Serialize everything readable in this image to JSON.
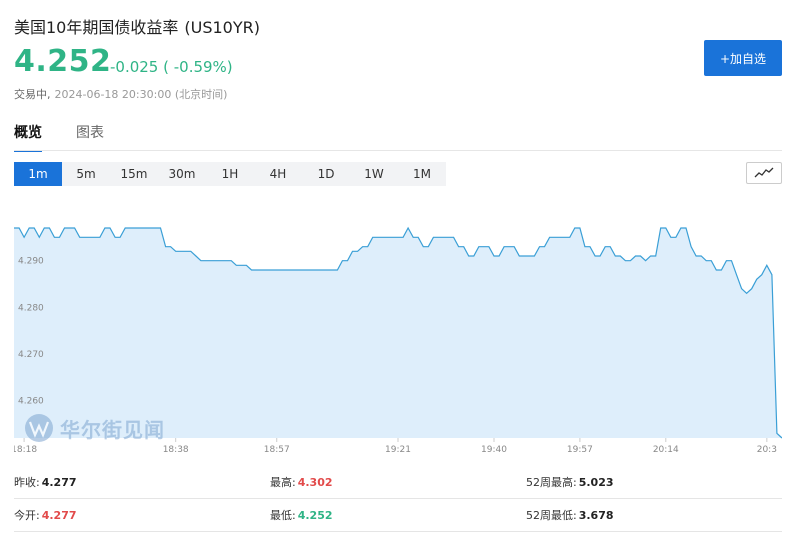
{
  "header": {
    "name": "美国10年期国债收益率",
    "code": "(US10YR)",
    "price": "4.252",
    "change": "-0.025 ( -0.59%)",
    "status": "交易中,",
    "timestamp": "2024-06-18 20:30:00 (北京时间)",
    "add_label": "+加自选"
  },
  "tabs": [
    "概览",
    "图表"
  ],
  "intervals": [
    "1m",
    "5m",
    "15m",
    "30m",
    "1H",
    "4H",
    "1D",
    "1W",
    "1M"
  ],
  "watermark": "华尔街见闻",
  "colors": {
    "line": "#3a9fd6",
    "fill": "#deeefb",
    "up": "#e24a4a",
    "down": "#2fb486",
    "accent": "#1a73d9"
  },
  "stats": {
    "rows": [
      [
        {
          "label": "昨收:",
          "value": "4.277",
          "tone": "flat"
        },
        {
          "label": "最高:",
          "value": "4.302",
          "tone": "up"
        },
        {
          "label": "52周最高:",
          "value": "5.023",
          "tone": "flat"
        }
      ],
      [
        {
          "label": "今开:",
          "value": "4.277",
          "tone": "up"
        },
        {
          "label": "最低:",
          "value": "4.252",
          "tone": "down"
        },
        {
          "label": "52周最低:",
          "value": "3.678",
          "tone": "flat"
        }
      ]
    ]
  },
  "chart_data": {
    "type": "area",
    "title": "",
    "xlabel": "",
    "ylabel": "",
    "ylim": [
      4.252,
      4.303
    ],
    "yticks": [
      4.29,
      4.28,
      4.27,
      4.26
    ],
    "ytick_labels": [
      "4.290",
      "4.280",
      "4.270",
      "4.260"
    ],
    "xtick_labels": [
      "18:18",
      "18:38",
      "18:57",
      "19:21",
      "19:40",
      "19:57",
      "20:14",
      "20:3"
    ],
    "xtick_index": [
      2,
      32,
      52,
      76,
      95,
      112,
      129,
      149
    ],
    "series": [
      {
        "values": [
          4.297,
          4.297,
          4.295,
          4.297,
          4.297,
          4.295,
          4.297,
          4.297,
          4.295,
          4.295,
          4.297,
          4.297,
          4.297,
          4.295,
          4.295,
          4.295,
          4.295,
          4.295,
          4.297,
          4.297,
          4.295,
          4.295,
          4.297,
          4.297,
          4.297,
          4.297,
          4.297,
          4.297,
          4.297,
          4.297,
          4.293,
          4.293,
          4.292,
          4.292,
          4.292,
          4.292,
          4.291,
          4.29,
          4.29,
          4.29,
          4.29,
          4.29,
          4.29,
          4.29,
          4.289,
          4.289,
          4.289,
          4.288,
          4.288,
          4.288,
          4.288,
          4.288,
          4.288,
          4.288,
          4.288,
          4.288,
          4.288,
          4.288,
          4.288,
          4.288,
          4.288,
          4.288,
          4.288,
          4.288,
          4.288,
          4.29,
          4.29,
          4.292,
          4.292,
          4.293,
          4.293,
          4.295,
          4.295,
          4.295,
          4.295,
          4.295,
          4.295,
          4.295,
          4.297,
          4.295,
          4.295,
          4.293,
          4.293,
          4.295,
          4.295,
          4.295,
          4.295,
          4.295,
          4.293,
          4.293,
          4.291,
          4.291,
          4.293,
          4.293,
          4.293,
          4.291,
          4.291,
          4.293,
          4.293,
          4.293,
          4.291,
          4.291,
          4.291,
          4.291,
          4.293,
          4.293,
          4.295,
          4.295,
          4.295,
          4.295,
          4.295,
          4.297,
          4.297,
          4.293,
          4.293,
          4.291,
          4.291,
          4.293,
          4.293,
          4.291,
          4.291,
          4.29,
          4.29,
          4.291,
          4.291,
          4.29,
          4.291,
          4.291,
          4.297,
          4.297,
          4.295,
          4.295,
          4.297,
          4.297,
          4.293,
          4.291,
          4.291,
          4.29,
          4.29,
          4.288,
          4.288,
          4.29,
          4.29,
          4.287,
          4.284,
          4.283,
          4.284,
          4.286,
          4.287,
          4.289,
          4.287,
          4.253,
          4.252
        ]
      }
    ]
  }
}
